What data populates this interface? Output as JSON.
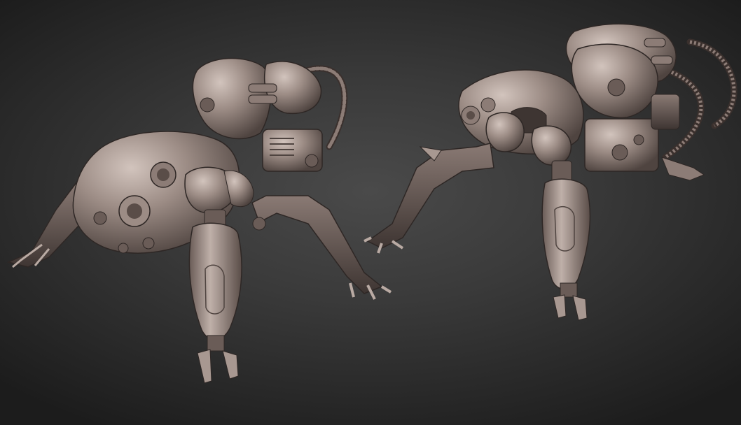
{
  "scene": {
    "subjects": [
      {
        "pose": "front-three-quarter"
      },
      {
        "pose": "rear-three-quarter"
      }
    ],
    "colors": {
      "background_center": "#4a4a4a",
      "background_edge": "#1c1c1c",
      "material_light": "#b9aaa3",
      "material_mid": "#8c7c76",
      "material_dark": "#4f4440"
    }
  }
}
